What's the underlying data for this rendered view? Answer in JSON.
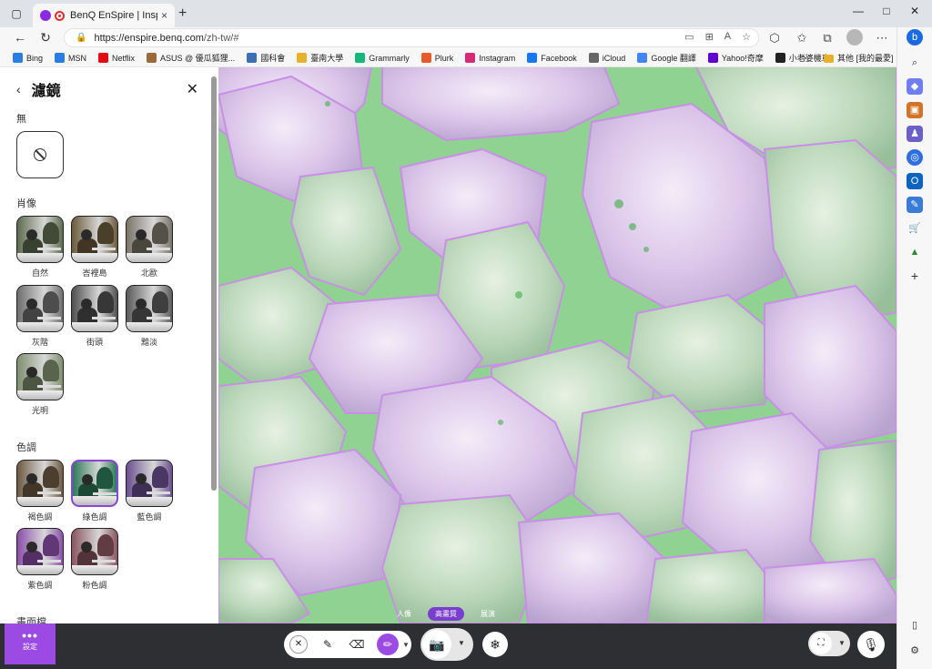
{
  "browser": {
    "tab_title": "BenQ EnSpire | Inspire peop",
    "tab_close": "×",
    "new_tab": "+",
    "window_controls": {
      "minimize": "—",
      "maximize": "□",
      "close": "✕"
    },
    "url_host": "https://enspire.benq.com",
    "url_path": "/zh-tw/#",
    "bookmarks": [
      {
        "label": "Bing",
        "color": "#2a7de1"
      },
      {
        "label": "MSN",
        "color": "#2a7de1"
      },
      {
        "label": "Netflix",
        "color": "#e50914"
      },
      {
        "label": "ASUS @ 優瓜狐狸...",
        "color": "#9c6b3b"
      },
      {
        "label": "國科會",
        "color": "#3b6fb6"
      },
      {
        "label": "臺南大學",
        "color": "#e8b12b"
      },
      {
        "label": "Grammarly",
        "color": "#15b878"
      },
      {
        "label": "Plurk",
        "color": "#e65a2b"
      },
      {
        "label": "Instagram",
        "color": "#d62976"
      },
      {
        "label": "Facebook",
        "color": "#1877f2"
      },
      {
        "label": "iCloud",
        "color": "#666666"
      },
      {
        "label": "Google 翻譯",
        "color": "#4285f4"
      },
      {
        "label": "Yahoo!奇摩",
        "color": "#6001d2"
      },
      {
        "label": "小老婆機車",
        "color": "#222222"
      }
    ],
    "bookmarks_more": "›",
    "bookmarks_other": "其他 [我的最愛]"
  },
  "panel": {
    "title": "濾鏡",
    "sections": {
      "none": "無",
      "portrait": "肖像",
      "tone": "色調",
      "frame": "畫面檔"
    },
    "portrait_filters": [
      {
        "label": "自然",
        "tint": "#5d6b4f"
      },
      {
        "label": "峇裡島",
        "tint": "#6a5a3a"
      },
      {
        "label": "北歐",
        "tint": "#7a7468"
      },
      {
        "label": "灰階",
        "tint": "#6e6e6e"
      },
      {
        "label": "街頭",
        "tint": "#4f4f4f"
      },
      {
        "label": "黯淡",
        "tint": "#5a5a5a"
      },
      {
        "label": "光明",
        "tint": "#7f8f6f"
      }
    ],
    "tone_filters": [
      {
        "label": "褐色調",
        "tint": "#6d5a42"
      },
      {
        "label": "綠色調",
        "tint": "#2e7a5a",
        "selected": true
      },
      {
        "label": "藍色調",
        "tint": "#6a4f8e"
      },
      {
        "label": "紫色調",
        "tint": "#8a4fa8"
      },
      {
        "label": "粉色調",
        "tint": "#8a5560"
      }
    ]
  },
  "view": {
    "modes": [
      "人像",
      "高畫質",
      "展演"
    ],
    "active_mode": "高畫質"
  },
  "toolbar": {
    "settings_label": "設定",
    "settings_dots": "•••"
  },
  "colors": {
    "accent": "#9b4be3",
    "toolbar_bg": "#2e2f33"
  }
}
